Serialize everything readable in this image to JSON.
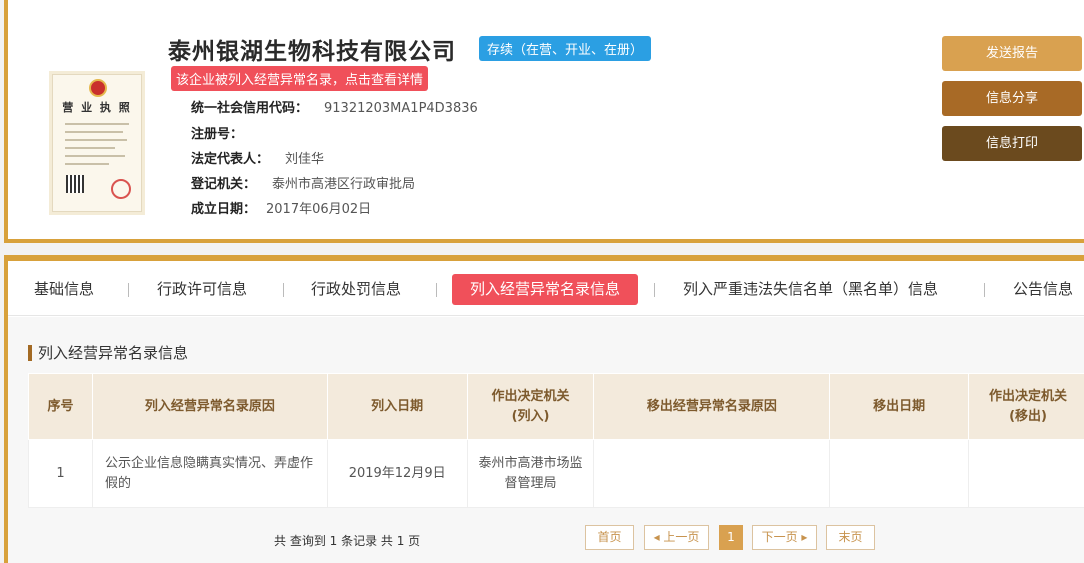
{
  "company": {
    "name": "泰州银湖生物科技有限公司",
    "status": "存续（在营、开业、在册）",
    "abnormal_alert": "该企业被列入经营异常名录，点击查看详情",
    "license_title": "营 业 执 照",
    "fields": [
      {
        "label": "统一社会信用代码：",
        "value": "91321203MA1P4D3836"
      },
      {
        "label": "注册号：",
        "value": ""
      },
      {
        "label": "法定代表人：",
        "value": "刘佳华"
      },
      {
        "label": "登记机关：",
        "value": "泰州市高港区行政审批局"
      },
      {
        "label": "成立日期：",
        "value": "2017年06月02日"
      }
    ]
  },
  "actions": {
    "send_report": "发送报告",
    "share_info": "信息分享",
    "print_info": "信息打印"
  },
  "tabs": [
    {
      "label": "基础信息"
    },
    {
      "label": "行政许可信息"
    },
    {
      "label": "行政处罚信息"
    },
    {
      "label": "列入经营异常名录信息"
    },
    {
      "label": "列入严重违法失信名单（黑名单）信息"
    },
    {
      "label": "公告信息"
    }
  ],
  "section": {
    "title": "列入经营异常名录信息"
  },
  "table": {
    "headers": [
      "序号",
      "列入经营异常名录原因",
      "列入日期",
      "作出决定机关\n(列入)",
      "移出经营异常名录原因",
      "移出日期",
      "作出决定机关\n(移出)"
    ],
    "rows": [
      [
        "1",
        "公示企业信息隐瞒真实情况、弄虚作假的",
        "2019年12月9日",
        "泰州市高港市场监督管理局",
        "",
        "",
        ""
      ]
    ]
  },
  "pager": {
    "summary": "共 查询到 1 条记录 共 1 页",
    "first": "首页",
    "prev": "上一页",
    "current": "1",
    "next": "下一页",
    "last": "末页"
  },
  "colors": {
    "gold": "#d8a13b",
    "status_blue": "#2b9fe3",
    "alert_red": "#f0505a",
    "btn_send": "#d9a150",
    "btn_share": "#a86a26",
    "btn_print": "#6b4a1e"
  }
}
